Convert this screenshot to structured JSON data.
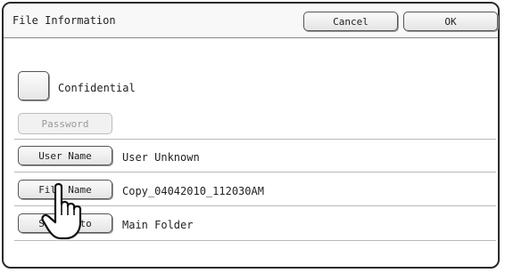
{
  "header": {
    "title": "File Information",
    "cancel_label": "Cancel",
    "ok_label": "OK"
  },
  "confidential": {
    "label": "Confidential"
  },
  "password_label": "Password",
  "rows": [
    {
      "button": "User Name",
      "value": "User Unknown"
    },
    {
      "button": "File Name",
      "value": "Copy_04042010_112030AM"
    },
    {
      "button": "Stored to",
      "value": "Main Folder"
    }
  ],
  "icons": {
    "cursor": "pointing-hand-icon"
  }
}
